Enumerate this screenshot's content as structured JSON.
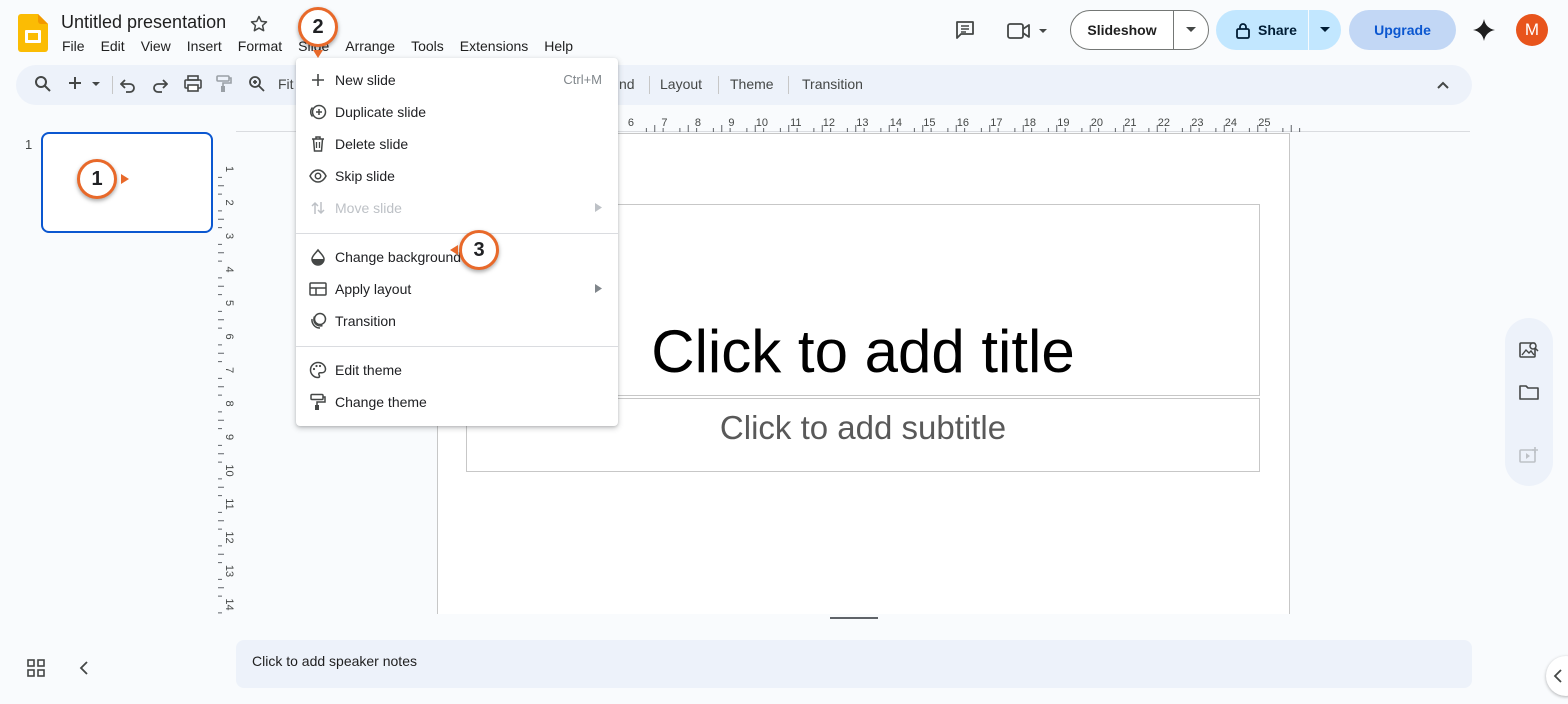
{
  "header": {
    "doc_title": "Untitled presentation",
    "menus": [
      "File",
      "Edit",
      "View",
      "Insert",
      "Format",
      "Slide",
      "Arrange",
      "Tools",
      "Extensions",
      "Help"
    ],
    "slideshow_label": "Slideshow",
    "share_label": "Share",
    "upgrade_label": "Upgrade",
    "avatar_letter": "M",
    "brand_color": "#fbbc04",
    "accent_color": "#0b57d0"
  },
  "toolbar": {
    "zoom_label": "Fit",
    "tabs": [
      "Background",
      "Layout",
      "Theme",
      "Transition"
    ],
    "background_partial": "nd"
  },
  "filmstrip": {
    "slide_number": "1"
  },
  "ruler": {
    "h_ticks": [
      "6",
      "7",
      "8",
      "9",
      "10",
      "11",
      "12",
      "13",
      "14",
      "15",
      "16",
      "17",
      "18",
      "19",
      "20",
      "21",
      "22",
      "23",
      "24",
      "25"
    ],
    "v_ticks": [
      "1",
      "2",
      "3",
      "4",
      "5",
      "6",
      "7",
      "8",
      "9",
      "10",
      "11",
      "12",
      "13",
      "14"
    ]
  },
  "slide": {
    "title_placeholder": "Click to add title",
    "subtitle_placeholder": "Click to add subtitle"
  },
  "notes": {
    "placeholder": "Click to add speaker notes"
  },
  "slide_menu": {
    "items": [
      {
        "label": "New slide",
        "shortcut": "Ctrl+M",
        "icon": "plus-icon"
      },
      {
        "label": "Duplicate slide",
        "icon": "duplicate-icon"
      },
      {
        "label": "Delete slide",
        "icon": "trash-icon"
      },
      {
        "label": "Skip slide",
        "icon": "eye-icon"
      },
      {
        "label": "Move slide",
        "icon": "move-icon",
        "disabled": true
      },
      {
        "label": "Change background",
        "icon": "droplet-icon"
      },
      {
        "label": "Apply layout",
        "icon": "layout-icon"
      },
      {
        "label": "Transition",
        "icon": "transition-icon"
      },
      {
        "label": "Edit theme",
        "icon": "palette-icon"
      },
      {
        "label": "Change theme",
        "icon": "paint-roller-icon"
      }
    ]
  },
  "callouts": [
    "1",
    "2",
    "3"
  ],
  "callout_color": "#e8692a"
}
